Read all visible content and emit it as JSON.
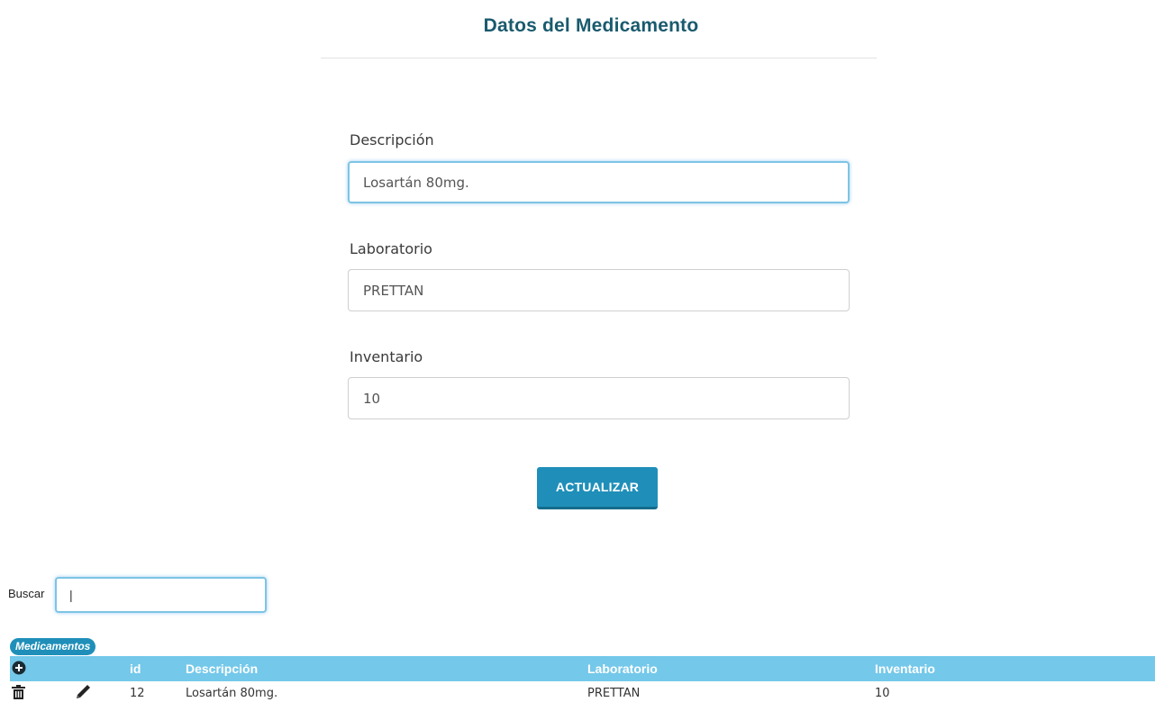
{
  "form": {
    "title": "Datos del Medicamento",
    "fields": [
      {
        "label": "Descripción",
        "value": "Losartán 80mg."
      },
      {
        "label": "Laboratorio",
        "value": "PRETTAN"
      },
      {
        "label": "Inventario",
        "value": "10"
      }
    ],
    "submit_label": "ACTUALIZAR"
  },
  "search": {
    "label": "Buscar",
    "value": "|"
  },
  "table": {
    "caption": "Medicamentos",
    "columns": [
      "id",
      "Descripción",
      "Laboratorio",
      "Inventario"
    ],
    "rows": [
      {
        "id": "12",
        "descripcion": "Losartán 80mg.",
        "laboratorio": "PRETTAN",
        "inventario": "10"
      }
    ]
  },
  "icons": {
    "add": "plus-circle-icon",
    "delete": "trash-icon",
    "edit": "pencil-icon"
  },
  "colors": {
    "title": "#1a5a6e",
    "accent": "#1f8fb9",
    "table_header": "#74c8ea",
    "focus_border": "#7dc4e4"
  }
}
